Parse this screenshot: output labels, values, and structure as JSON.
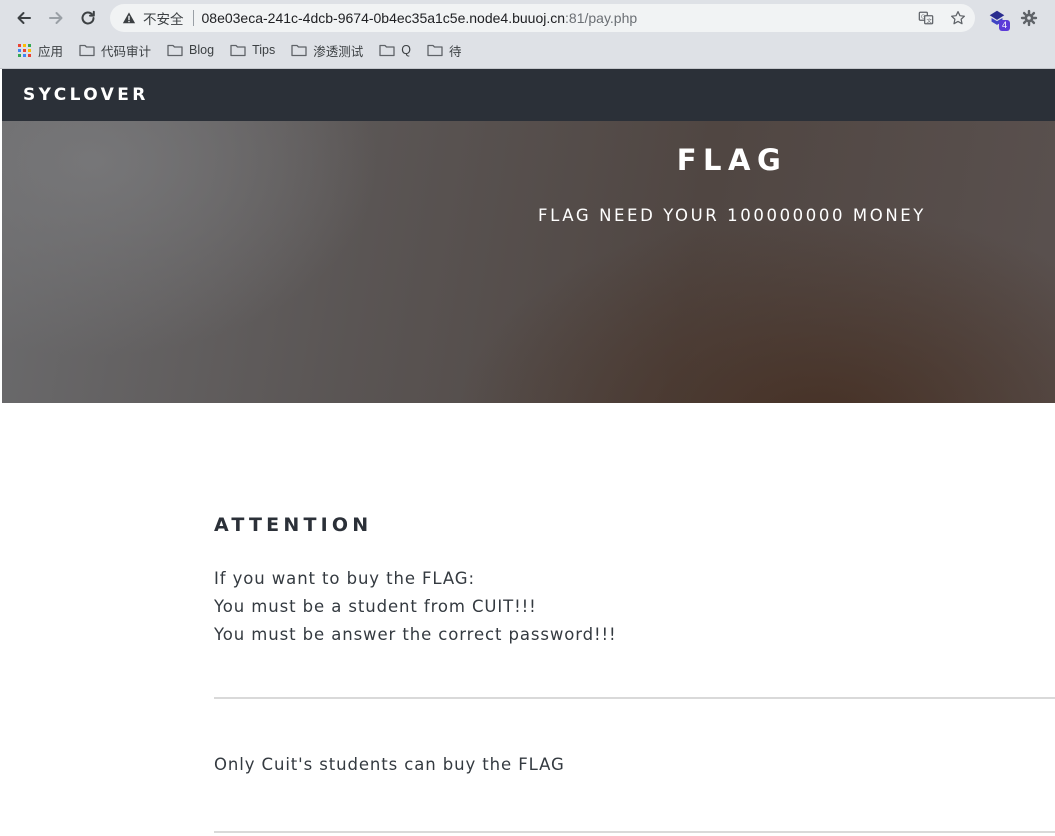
{
  "browser": {
    "security_label": "不安全",
    "url_host": "08e03eca-241c-4dcb-9674-0b4ec35a1c5e.node4.buuoj.cn",
    "url_rest": ":81/pay.php",
    "extension_badge": "4",
    "bookmarks": [
      {
        "label": "应用",
        "icon": "apps-grid-icon"
      },
      {
        "label": "代码审计",
        "icon": "folder-icon"
      },
      {
        "label": "Blog",
        "icon": "folder-icon"
      },
      {
        "label": "Tips",
        "icon": "folder-icon"
      },
      {
        "label": "渗透测试",
        "icon": "folder-icon"
      },
      {
        "label": "Q",
        "icon": "folder-icon"
      },
      {
        "label": "待",
        "icon": "folder-icon"
      }
    ]
  },
  "site": {
    "brand": "SYCLOVER"
  },
  "hero": {
    "title": "FLAG",
    "subtitle": "FLAG NEED YOUR 100000000 MONEY"
  },
  "attention": {
    "title": "ATTENTION",
    "lines": [
      "If you want to buy the FLAG:",
      "You must be a student from CUIT!!!",
      "You must be answer the correct password!!!"
    ]
  },
  "note": "Only Cuit's students can buy the FLAG",
  "colors": {
    "nav_bg": "#2b3038",
    "text": "#343a40",
    "chrome_bg": "#dee1e6"
  }
}
